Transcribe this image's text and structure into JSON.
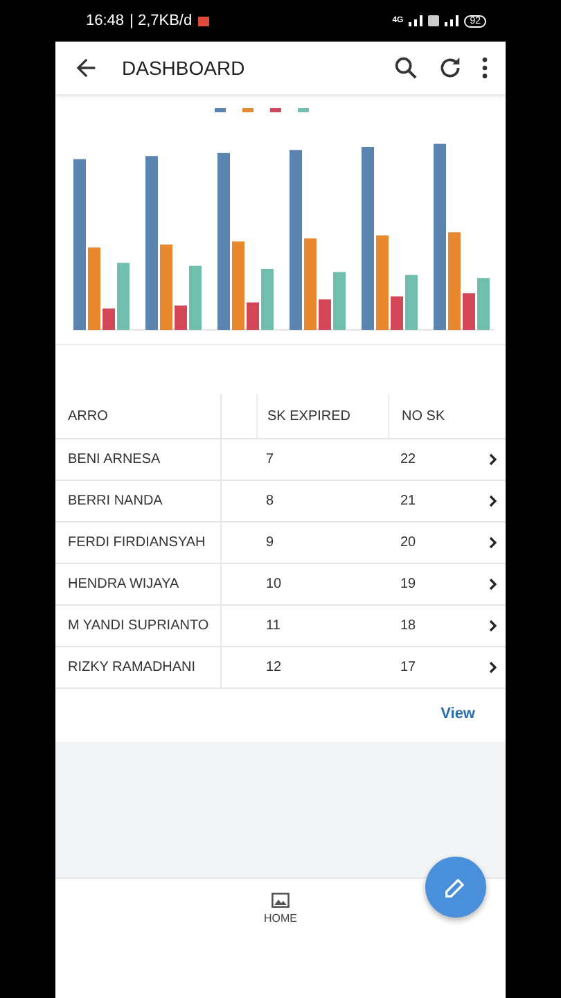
{
  "status_bar": {
    "time": "16:48",
    "speed": "| 2,7KB/d",
    "network": "4G",
    "battery": "92"
  },
  "app_bar": {
    "title": "DASHBOARD"
  },
  "table": {
    "columns": [
      "ARRO",
      "SK EXPIRED",
      "NO SK"
    ],
    "rows": [
      {
        "cells": [
          "BENI ARNESA",
          "7",
          "22"
        ]
      },
      {
        "cells": [
          "BERRI NANDA",
          "8",
          "21"
        ]
      },
      {
        "cells": [
          "FERDI FIRDIANSYAH",
          "9",
          "20"
        ]
      },
      {
        "cells": [
          "HENDRA WIJAYA",
          "10",
          "19"
        ]
      },
      {
        "cells": [
          "M YANDI SUPRIANTO",
          "11",
          "18"
        ]
      },
      {
        "cells": [
          "RIZKY RAMADHANI",
          "12",
          "17"
        ]
      }
    ]
  },
  "view_link": "View",
  "bottom_nav": [
    {
      "label": "HOME",
      "selected": true
    }
  ]
}
